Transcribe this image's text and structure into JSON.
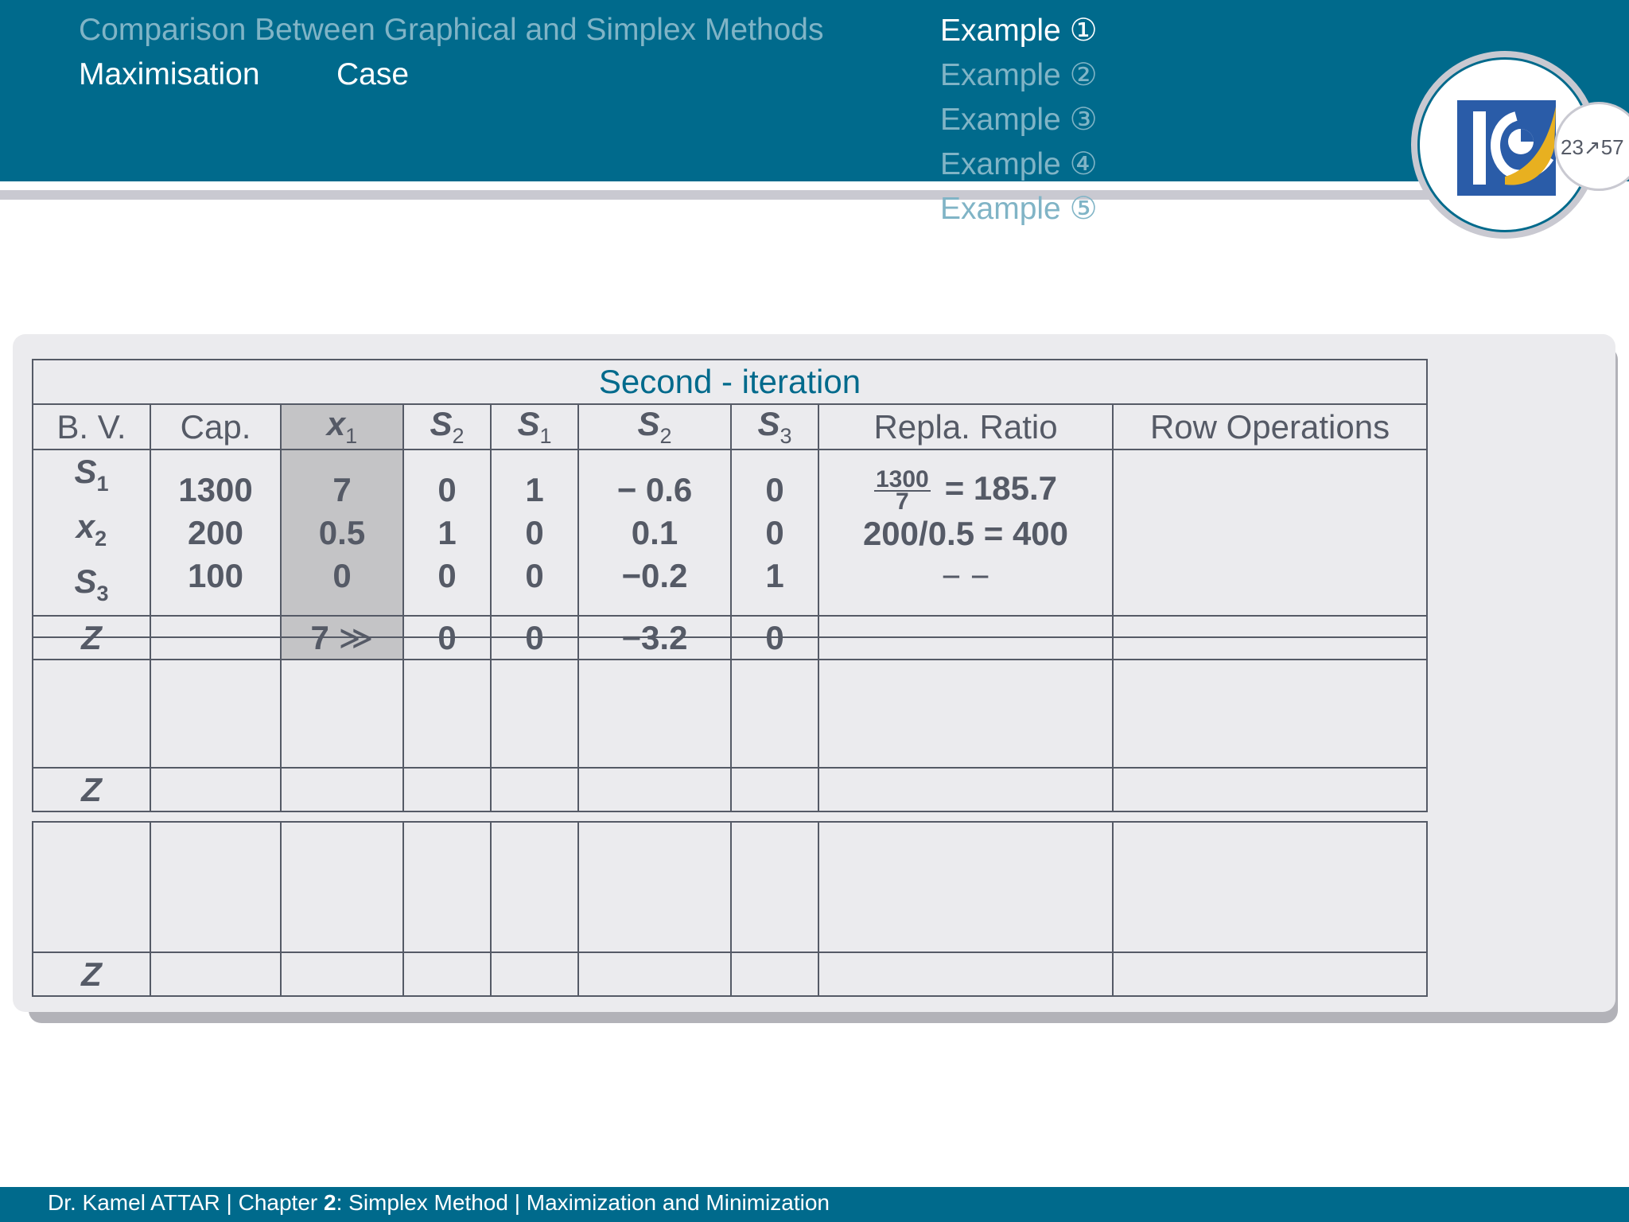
{
  "header": {
    "section_title": "Comparison Between Graphical and Simplex Methods",
    "subsection_1": "Maximisation",
    "subsection_2": "Case",
    "examples": [
      "Example ①",
      "Example ②",
      "Example ③",
      "Example ④",
      "Example ⑤"
    ],
    "active_example_index": 0,
    "page_indicator": "23↗57"
  },
  "colors": {
    "header_bg": "#006a8c",
    "header_muted_text": "#80b4c6",
    "panel_bg": "#ebebee",
    "pivot_column": "#c4c4c6",
    "text": "#555a66",
    "logo_blue": "#2a5ca8",
    "logo_gold": "#e8b020"
  },
  "iteration_table": {
    "title": "Second - iteration",
    "headers": {
      "bv": "B. V.",
      "cap": "Cap.",
      "c1": {
        "var": "x",
        "sub": "1"
      },
      "c2": {
        "var": "S",
        "sub": "2"
      },
      "c3": {
        "var": "S",
        "sub": "1"
      },
      "c4": {
        "var": "S",
        "sub": "2"
      },
      "c5": {
        "var": "S",
        "sub": "3"
      },
      "ratio": "Repla. Ratio",
      "ops": "Row Operations"
    },
    "basic_vars": [
      {
        "var": "S",
        "sub": "1"
      },
      {
        "var": "x",
        "sub": "2"
      },
      {
        "var": "S",
        "sub": "3"
      }
    ],
    "cap": [
      "1300",
      "200",
      "100"
    ],
    "col_x1": [
      "7",
      "0.5",
      "0"
    ],
    "col_s2a": [
      "0",
      "1",
      "0"
    ],
    "col_s1": [
      "1",
      "0",
      "0"
    ],
    "col_s2b": [
      "− 0.6",
      "0.1",
      "−0.2"
    ],
    "col_s3": [
      "0",
      "0",
      "1"
    ],
    "ratio": {
      "row1_num": "1300",
      "row1_den": "7",
      "row1_result": "= 185.7",
      "row2": "200/0.5 = 400",
      "row3": "− −"
    },
    "z_row": {
      "label": "Z",
      "cap": "",
      "x1": "7",
      "x1_marker": "≫",
      "s2a": "0",
      "s1": "0",
      "s2b": "−3.2",
      "s3": "0",
      "ratio": "",
      "ops": ""
    }
  },
  "empty_tables": {
    "z_label": "Z"
  },
  "footer": {
    "author": "Dr. Kamel ATTAR | Chapter ",
    "chapter_num": "2",
    "rest": ": Simplex Method | Maximization and Minimization"
  }
}
